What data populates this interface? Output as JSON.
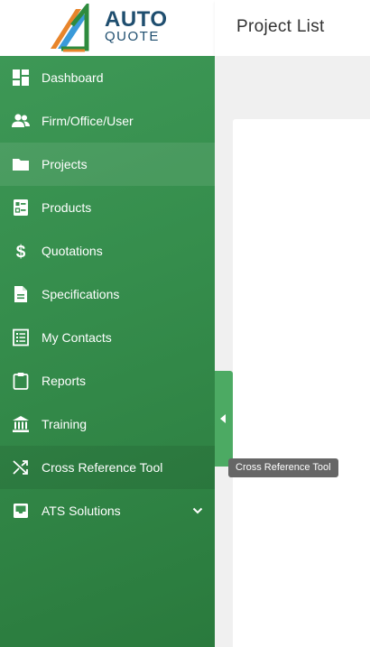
{
  "brand": {
    "line1": "AUTO",
    "line2": "QUOTE"
  },
  "header": {
    "title": "Project List"
  },
  "sidebar": {
    "items": [
      {
        "label": "Dashboard",
        "icon": "dashboard-icon"
      },
      {
        "label": "Firm/Office/User",
        "icon": "users-icon"
      },
      {
        "label": "Projects",
        "icon": "folder-icon",
        "active": true
      },
      {
        "label": "Products",
        "icon": "product-list-icon"
      },
      {
        "label": "Quotations",
        "icon": "dollar-icon"
      },
      {
        "label": "Specifications",
        "icon": "document-icon"
      },
      {
        "label": "My Contacts",
        "icon": "contacts-list-icon"
      },
      {
        "label": "Reports",
        "icon": "clipboard-icon"
      },
      {
        "label": "Training",
        "icon": "institution-icon"
      },
      {
        "label": "Cross Reference Tool",
        "icon": "shuffle-icon",
        "hovered": true
      },
      {
        "label": "ATS Solutions",
        "icon": "inbox-icon",
        "expandable": true
      }
    ]
  },
  "tooltip": {
    "text": "Cross Reference Tool"
  },
  "colors": {
    "sidebar": "#358d4c",
    "toggle": "#4caa63",
    "brand": "#1f4e6f"
  }
}
